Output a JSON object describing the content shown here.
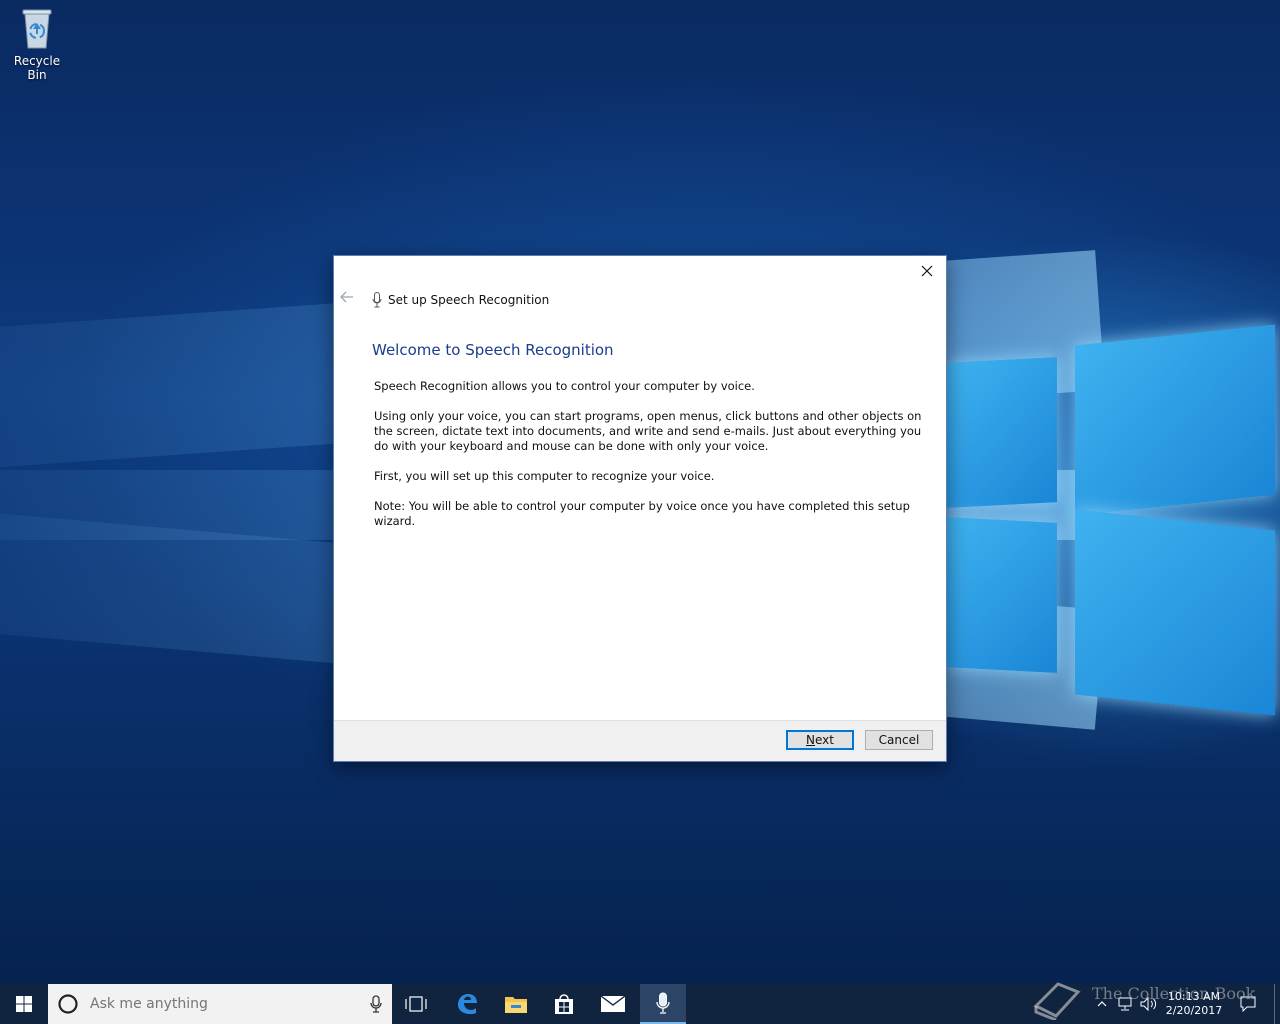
{
  "desktop": {
    "icons": [
      {
        "label": "Recycle Bin",
        "icon": "recycle-bin-icon"
      }
    ]
  },
  "dialog": {
    "title": "Set up Speech Recognition",
    "heading": "Welcome to Speech Recognition",
    "paragraphs": [
      "Speech Recognition allows you to control your computer by voice.",
      "Using only your voice, you can start programs, open menus, click buttons and other objects on the screen, dictate text into documents, and write and send e-mails. Just about everything you do with your keyboard and mouse can be done with only your voice.",
      "First, you will set up this computer to recognize your voice.",
      "Note: You will be able to control your computer by voice once you have completed this setup wizard."
    ],
    "next_label": "Next",
    "next_accesskey": "N",
    "cancel_label": "Cancel",
    "accent_color": "#1b3d8f"
  },
  "taskbar": {
    "search_placeholder": "Ask me anything",
    "pinned": [
      "task-view-icon",
      "edge-icon",
      "file-explorer-icon",
      "store-icon",
      "mail-icon",
      "speech-recognition-icon"
    ],
    "clock_time": "10:13 AM",
    "clock_date": "2/20/2017",
    "watermark": "The Collection Book",
    "accent_color": "#0078d7"
  }
}
